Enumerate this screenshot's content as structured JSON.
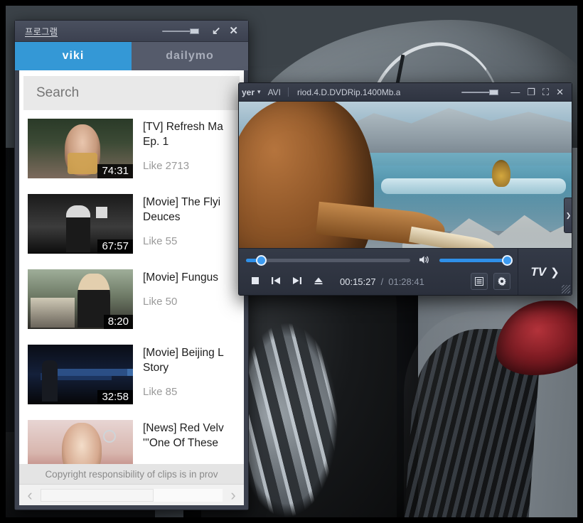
{
  "program_window": {
    "title": "프로그램",
    "titlebar_icons": [
      {
        "name": "volume-slider",
        "glyph": ""
      },
      {
        "name": "restore-down",
        "glyph": "↙"
      },
      {
        "name": "close",
        "glyph": "✕"
      }
    ],
    "tabs": [
      {
        "label": "viki",
        "active": true
      },
      {
        "label": "dailymo",
        "active": false
      }
    ],
    "search": {
      "value": "Search",
      "placeholder": "Search"
    },
    "videos": [
      {
        "title_line1": "[TV] Refresh Ma",
        "title_line2": "Ep. 1",
        "duration": "74:31",
        "likes": "Like 2713",
        "art": "t1"
      },
      {
        "title_line1": "[Movie] The Flyi",
        "title_line2": "Deuces",
        "duration": "67:57",
        "likes": "Like 55",
        "art": "t2"
      },
      {
        "title_line1": "[Movie] Fungus",
        "title_line2": "",
        "duration": "8:20",
        "likes": "Like 50",
        "art": "t3"
      },
      {
        "title_line1": "[Movie] Beijing L",
        "title_line2": "Story",
        "duration": "32:58",
        "likes": "Like 85",
        "art": "t4"
      },
      {
        "title_line1": "[News] Red Velv",
        "title_line2": "'''One Of These ",
        "duration": "",
        "likes": "",
        "art": "t5"
      }
    ],
    "copyright_notice": "Copyright responsibility of clips is in prov",
    "hscroll": {
      "left_arrow": "‹",
      "right_arrow": "›"
    },
    "colors": {
      "tab_active": "#3498d6",
      "tab_inactive": "#555b6b",
      "chrome": "#3d424f"
    }
  },
  "player_window": {
    "app_name": "yer",
    "caret": "▾",
    "format": "AVI",
    "filename": "riod.4.D.DVDRip.1400Mb.a",
    "titlebar_icons": [
      {
        "name": "volume-slider",
        "glyph": ""
      },
      {
        "name": "minimize",
        "glyph": "—"
      },
      {
        "name": "maximize",
        "glyph": "❐"
      },
      {
        "name": "fullscreen",
        "glyph": "⛶"
      },
      {
        "name": "close",
        "glyph": "✕"
      }
    ],
    "side_panel_arrow": "❯",
    "seek_percent": 9,
    "volume_percent": 100,
    "transport": [
      {
        "name": "stop-button",
        "glyph": "■"
      },
      {
        "name": "previous-button",
        "glyph": "❘◀"
      },
      {
        "name": "next-button",
        "glyph": "▶❘"
      },
      {
        "name": "eject-button",
        "glyph": "⏏"
      }
    ],
    "time_current": "00:15:27",
    "time_separator": "/",
    "time_total": "01:28:41",
    "right_buttons": [
      {
        "name": "playlist-button",
        "glyph": "▤"
      },
      {
        "name": "settings-gear-button",
        "glyph": "✿"
      }
    ],
    "tv_label": "TV",
    "tv_arrow": "❯",
    "speaker_glyph": "🔊",
    "colors": {
      "accent": "#2f90e8",
      "chrome": "#2b2f3a"
    }
  }
}
